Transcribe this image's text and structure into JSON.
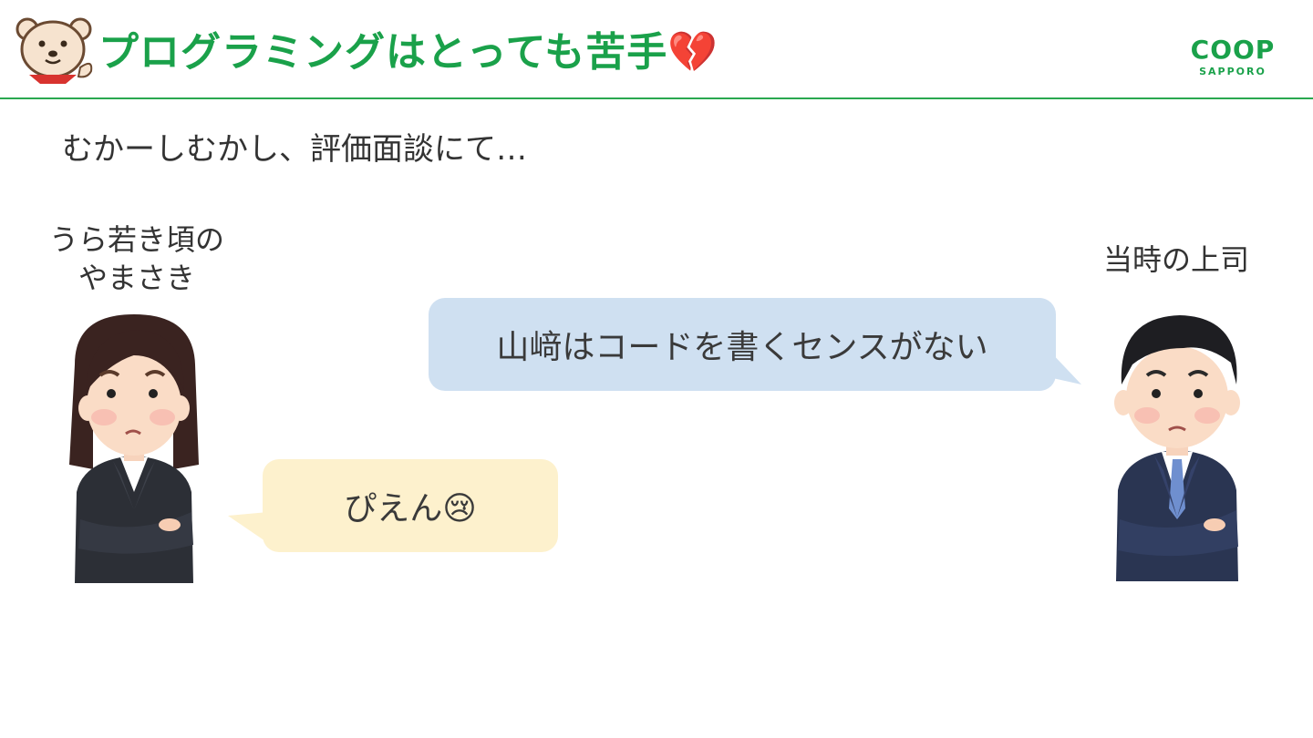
{
  "header": {
    "title": "プログラミングはとっても苦手💔",
    "logo_main": "COOP",
    "logo_sub": "SAPPORO"
  },
  "subtitle": "むかーしむかし、評価面談にて…",
  "left_person": {
    "label_line1": "うら若き頃の",
    "label_line2": "やまさき",
    "speech": "ぴえん😢"
  },
  "right_person": {
    "label": "当時の上司",
    "speech": "山﨑はコードを書くセンスがない"
  },
  "colors": {
    "accent_green": "#1aa14a",
    "bubble_blue": "#cfe0f1",
    "bubble_yellow": "#fdf1cd",
    "text": "#333333"
  }
}
